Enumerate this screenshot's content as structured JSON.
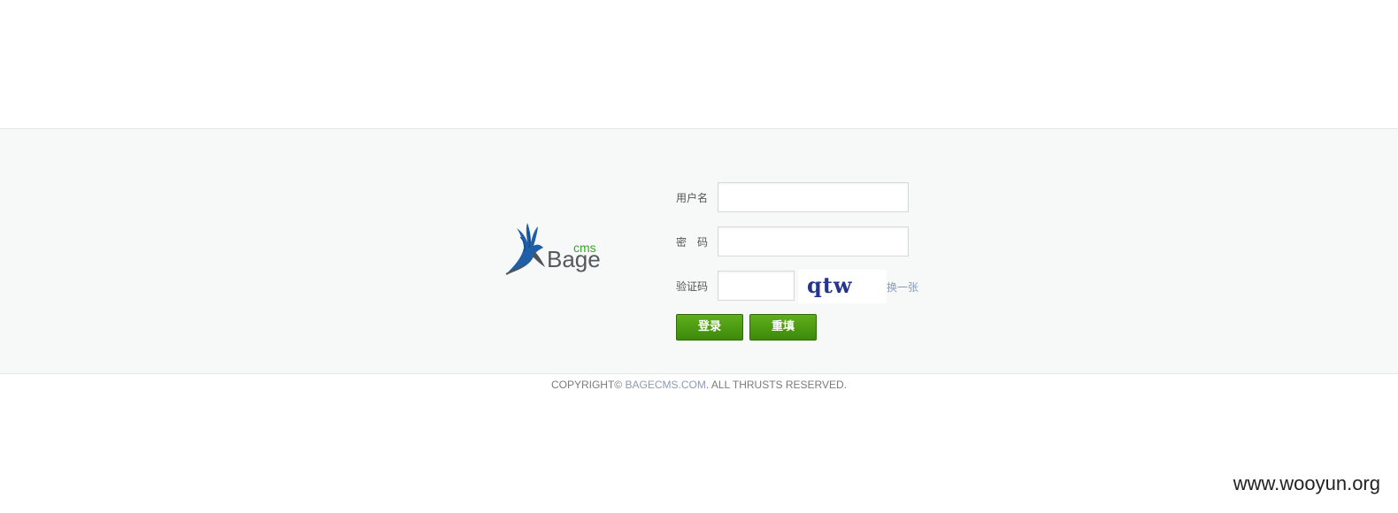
{
  "logo": {
    "word": "Bage",
    "sub": "cms"
  },
  "form": {
    "username_label": "用户名",
    "password_label": "密　码",
    "captcha_label": "验证码",
    "username_value": "",
    "password_value": "",
    "captcha_value": "",
    "captcha_image_text": "qtw",
    "refresh_label": "换一张",
    "login_label": "登录",
    "reset_label": "重填"
  },
  "footer": {
    "copyright_prefix": "COPYRIGHT©",
    "link": "BAGECMS.COM",
    "suffix": ". ALL THRUSTS RESERVED."
  },
  "watermark": "www.wooyun.org",
  "colors": {
    "button_green": "#3c8a0a",
    "link_blue": "#8a9bb5",
    "logo_bird": "#1f5fa8",
    "logo_cms": "#39a42b"
  }
}
